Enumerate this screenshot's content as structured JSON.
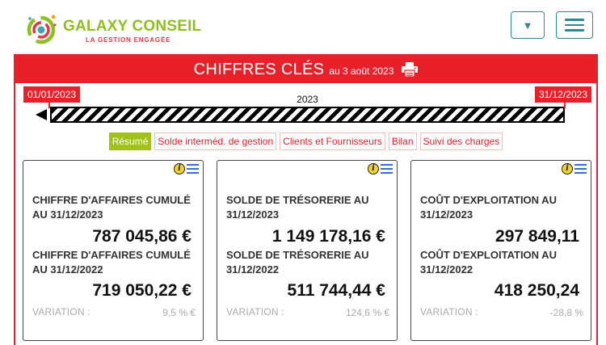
{
  "header": {
    "brand_name": "GALAXY CONSEIL",
    "brand_tagline": "LA GESTION ENGAGÉE",
    "dropdown_glyph": "▼",
    "menu_icon": "hamburger-icon"
  },
  "panel": {
    "title": "CHIFFRES CLÉS",
    "date_text": "au 3 août 2023",
    "print_icon": "printer-icon"
  },
  "timeline": {
    "start_date": "01/01/2023",
    "end_date": "31/12/2023",
    "year": "2023"
  },
  "tabs": [
    {
      "label": "Résumé",
      "active": true
    },
    {
      "label": "Solde interméd. de gestion",
      "active": false
    },
    {
      "label": "Clients et Fournisseurs",
      "active": false
    },
    {
      "label": "Bilan",
      "active": false
    },
    {
      "label": "Suivi des charges",
      "active": false
    }
  ],
  "cards": [
    {
      "label_current": "CHIFFRE D'AFFAIRES CUMULÉ AU 31/12/2023",
      "value_current": "787 045,86 €",
      "label_previous": "CHIFFRE D'AFFAIRES CUMULÉ AU 31/12/2022",
      "value_previous": "719 050,22 €",
      "variation_label": "VARIATION :",
      "variation_value": "9,5 % €"
    },
    {
      "label_current": "SOLDE DE TRÉSORERIE AU 31/12/2023",
      "value_current": "1 149 178,16 €",
      "label_previous": "SOLDE DE TRÉSORERIE AU 31/12/2022",
      "value_previous": "511 744,44 €",
      "variation_label": "VARIATION :",
      "variation_value": "124,6 % €"
    },
    {
      "label_current": "COÛT D'EXPLOITATION AU 31/12/2023",
      "value_current": "297 849,11",
      "label_previous": "COÛT D'EXPLOITATION AU 31/12/2022",
      "value_previous": "418 250,24",
      "variation_label": "VARIATION :",
      "variation_value": "-28,8 %"
    }
  ],
  "colors": {
    "brand_red": "#e8202a",
    "brand_green": "#a0c21a",
    "button_teal": "#2b8a8e",
    "info_yellow": "#f2d22b",
    "list_blue": "#3b6fd8"
  }
}
